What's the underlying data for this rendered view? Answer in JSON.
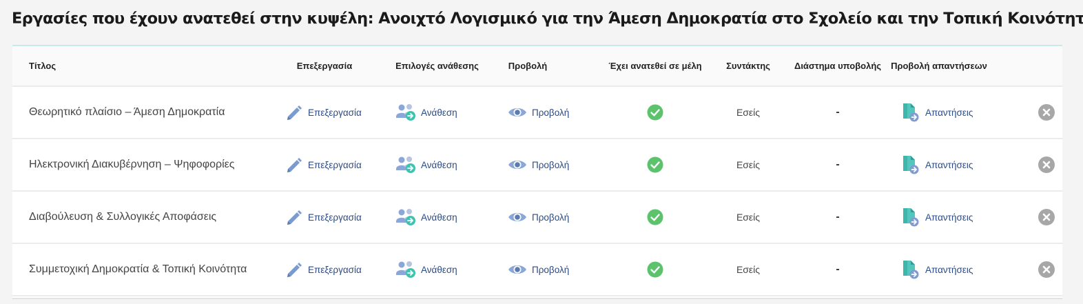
{
  "page": {
    "title": "Εργασίες που έχουν ανατεθεί στην κυψέλη: Ανοιχτό Λογισμικό για την Άμεση Δημοκρατία στο Σχολείο και την Τοπική Κοινότητα"
  },
  "table": {
    "headers": {
      "title": "Τίτλος",
      "edit": "Επεξεργασία",
      "assign_options": "Επιλογές ανάθεσης",
      "view": "Προβολή",
      "assigned_to_members": "Έχει ανατεθεί σε μέλη",
      "author": "Συντάκτης",
      "submission_period": "Διάστημα υποβολής",
      "view_answers": "Προβολή απαντήσεων"
    },
    "rows": [
      {
        "title": "Θεωρητικό πλαίσιο – Άμεση Δημοκρατία",
        "edit_label": "Επεξεργασία",
        "assign_label": "Ανάθεση",
        "view_label": "Προβολή",
        "assigned": true,
        "author": "Εσείς",
        "period": "-",
        "answers_label": "Απαντήσεις"
      },
      {
        "title": "Ηλεκτρονική Διακυβέρνηση – Ψηφοφορίες",
        "edit_label": "Επεξεργασία",
        "assign_label": "Ανάθεση",
        "view_label": "Προβολή",
        "assigned": true,
        "author": "Εσείς",
        "period": "-",
        "answers_label": "Απαντήσεις"
      },
      {
        "title": "Διαβούλευση & Συλλογικές Αποφάσεις",
        "edit_label": "Επεξεργασία",
        "assign_label": "Ανάθεση",
        "view_label": "Προβολή",
        "assigned": true,
        "author": "Εσείς",
        "period": "-",
        "answers_label": "Απαντήσεις"
      },
      {
        "title": "Συμμετοχική Δημοκρατία & Τοπική Κοινότητα",
        "edit_label": "Επεξεργασία",
        "assign_label": "Ανάθεση",
        "view_label": "Προβολή",
        "assigned": true,
        "author": "Εσείς",
        "period": "-",
        "answers_label": "Απαντήσεις"
      }
    ]
  },
  "icons": {
    "edit": "pencil-icon",
    "assign": "assign-users-icon",
    "view": "eye-icon",
    "assigned": "check-circle-icon",
    "answers": "document-arrow-icon",
    "delete": "close-circle-icon"
  },
  "colors": {
    "link": "#2a4a86",
    "icon_blue": "#7a9bd0",
    "check_green": "#5cc26c",
    "answers_teal": "#4fc4b7",
    "delete_grey": "#a7a7a7",
    "card_accent": "#c6ece8"
  }
}
